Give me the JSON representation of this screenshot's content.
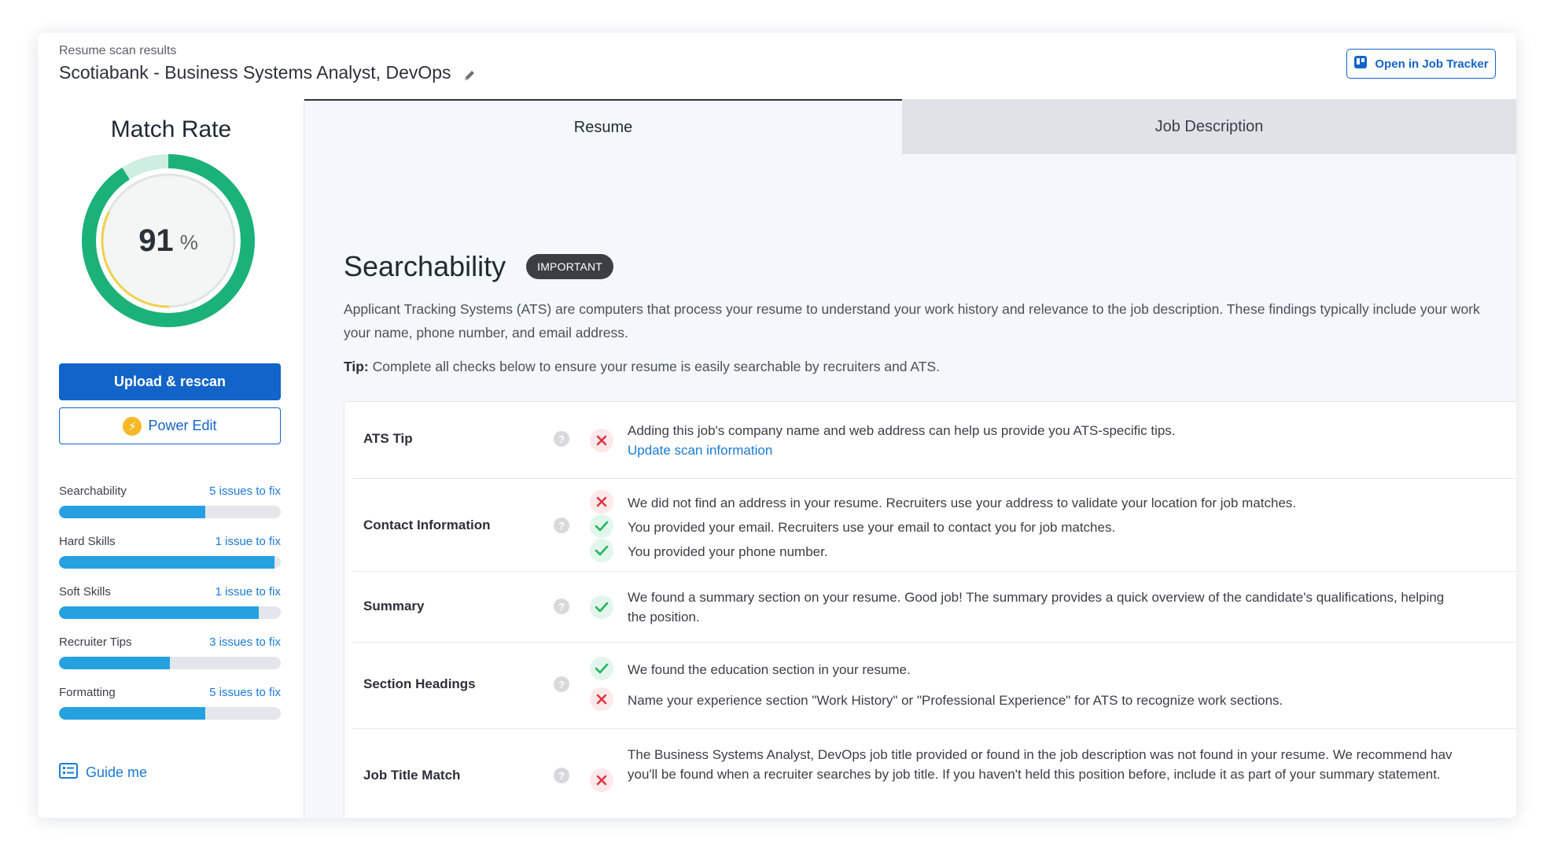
{
  "header": {
    "crumb": "Resume scan results",
    "title": "Scotiabank - Business Systems Analyst, DevOps",
    "tracker_button": "Open in Job Tracker"
  },
  "sidebar": {
    "match_title": "Match Rate",
    "match_value": "91",
    "match_unit": "%",
    "upload_button": "Upload & rescan",
    "power_button": "Power Edit",
    "categories": [
      {
        "name": "Searchability",
        "issues": "5 issues to fix",
        "progress": 0.66
      },
      {
        "name": "Hard Skills",
        "issues": "1 issue to fix",
        "progress": 0.97
      },
      {
        "name": "Soft Skills",
        "issues": "1 issue to fix",
        "progress": 0.9
      },
      {
        "name": "Recruiter Tips",
        "issues": "3 issues to fix",
        "progress": 0.5
      },
      {
        "name": "Formatting",
        "issues": "5 issues to fix",
        "progress": 0.66
      }
    ],
    "guide": "Guide me"
  },
  "tabs": {
    "resume": "Resume",
    "job_description": "Job Description"
  },
  "section": {
    "title": "Searchability",
    "badge": "IMPORTANT",
    "desc1": "Applicant Tracking Systems (ATS) are computers that process your resume to understand your work history and relevance to the job description. These findings typically include your work",
    "desc2": "your name, phone number, and email address.",
    "tip_label": "Tip:",
    "tip_text": " Complete all checks below to ensure your resume is easily searchable by recruiters and ATS."
  },
  "rows": [
    {
      "label": "ATS Tip",
      "items": [
        {
          "status": "bad",
          "text": "Adding this job's company name and web address can help us provide you ATS-specific tips.",
          "link": "Update scan information"
        }
      ]
    },
    {
      "label": "Contact Information",
      "items": [
        {
          "status": "bad",
          "text": "We did not find an address in your resume. Recruiters use your address to validate your location for job matches."
        },
        {
          "status": "good",
          "text": "You provided your email. Recruiters use your email to contact you for job matches."
        },
        {
          "status": "good",
          "text": "You provided your phone number."
        }
      ]
    },
    {
      "label": "Summary",
      "items": [
        {
          "status": "good",
          "text": "We found a summary section on your resume. Good job! The summary provides a quick overview of the candidate's qualifications, helping",
          "text2": "the position."
        }
      ]
    },
    {
      "label": "Section Headings",
      "items": [
        {
          "status": "good",
          "text": "We found the education section in your resume."
        },
        {
          "status": "bad",
          "text": "Name your experience section \"Work History\" or \"Professional Experience\" for ATS to recognize work sections."
        }
      ]
    },
    {
      "label": "Job Title Match",
      "items": [
        {
          "status": "bad",
          "text": "The Business Systems Analyst, DevOps job title provided or found in the job description was not found in your resume. We recommend hav",
          "text2": "you'll be found when a recruiter searches by job title. If you haven't held this position before, include it as part of your summary statement."
        }
      ]
    }
  ],
  "colors": {
    "accent": "#1264c9",
    "gauge_green": "#1bb27a",
    "gauge_yellow": "#f2d14b",
    "bar_fill": "#26a1e0",
    "bad": "#e0323f",
    "good": "#26b45f"
  }
}
